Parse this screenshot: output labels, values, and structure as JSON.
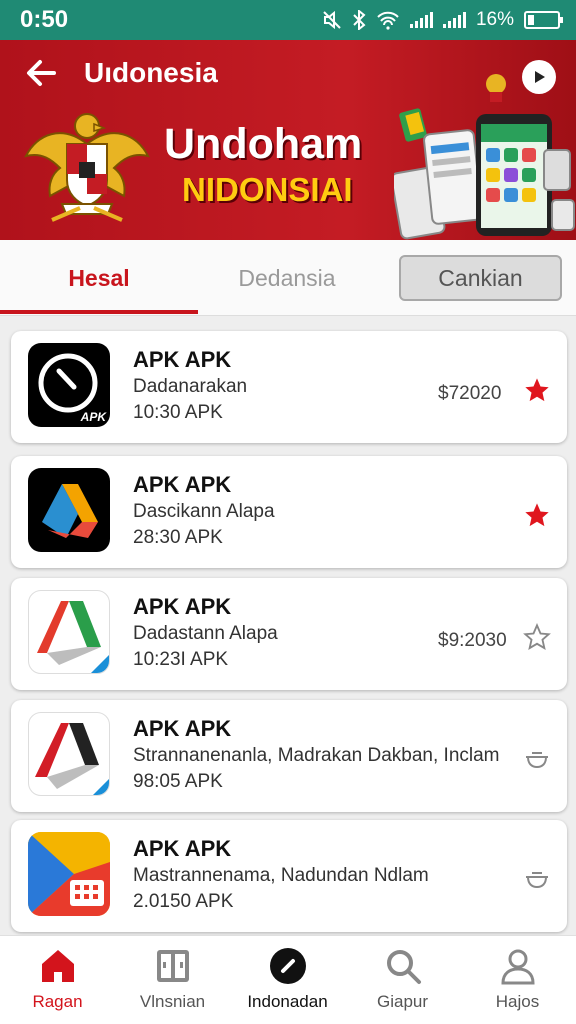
{
  "status_bar": {
    "time": "0:50",
    "battery": "16%"
  },
  "header": {
    "title": "Uıdonesia",
    "banner_line1": "Undoham",
    "banner_line2": "NIDONSIAI"
  },
  "tabs": [
    {
      "label": "Hesal",
      "active": true
    },
    {
      "label": "Dedansia",
      "active": false
    },
    {
      "label": "Cankian",
      "active": false
    }
  ],
  "apps": [
    {
      "name": "APK APK",
      "subtitle": "Dadanarakan",
      "version": "10:30 APK",
      "price": "$72020",
      "trailing_icon": "star-filled-icon",
      "icon_badge": "APK"
    },
    {
      "name": "APK APK",
      "subtitle": "Dascikann Alapa",
      "version": "28:30 APK",
      "price": "",
      "trailing_icon": "star-filled-icon",
      "icon_badge": ""
    },
    {
      "name": "APK APK",
      "subtitle": "Dadastann Alapa",
      "version": "10:23I APK",
      "price": "$9:2030",
      "trailing_icon": "star-outline-icon",
      "icon_badge": ""
    },
    {
      "name": "APK APK",
      "subtitle": "Strannanenanla, Madrakan Dakban, Inclam",
      "version": "98:05 APK",
      "price": "",
      "trailing_icon": "bowl-icon",
      "icon_badge": ""
    },
    {
      "name": "APK APK",
      "subtitle": "Mastrannenama, Nadundan Ndlam",
      "version": "2.0150 APK",
      "price": "",
      "trailing_icon": "bowl-icon",
      "icon_badge": ""
    }
  ],
  "bottom_nav": [
    {
      "label": "Ragan",
      "icon": "home-icon",
      "active": true
    },
    {
      "label": "Vlnsnian",
      "icon": "book-icon",
      "active": false
    },
    {
      "label": "Indonadan",
      "icon": "compass-icon",
      "active": false
    },
    {
      "label": "Giapur",
      "icon": "search-icon",
      "active": false
    },
    {
      "label": "Hajos",
      "icon": "person-icon",
      "active": false
    }
  ],
  "colors": {
    "status_bar": "#1f8a74",
    "brand_red": "#c8151d",
    "star": "#e0161e",
    "banner_yellow": "#ffcc11"
  }
}
